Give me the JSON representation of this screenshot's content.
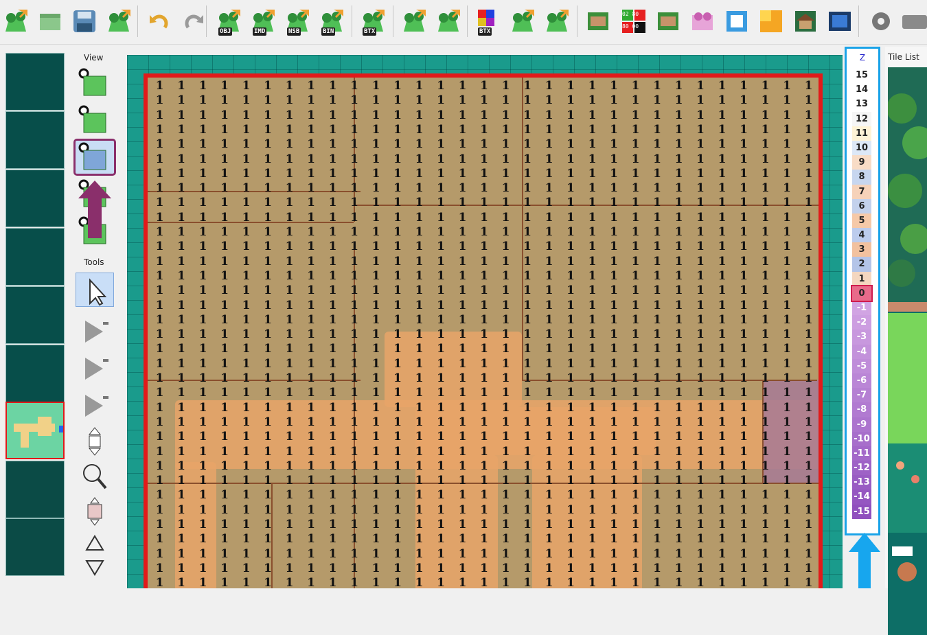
{
  "toolbar": {
    "buttons": [
      {
        "icon": "new-map-icon"
      },
      {
        "icon": "open-map-icon"
      },
      {
        "icon": "save-icon"
      },
      {
        "icon": "export-map-icon"
      },
      {
        "icon": "undo-icon"
      },
      {
        "icon": "redo-icon"
      },
      {
        "icon": "export-obj-icon",
        "label": "OBJ"
      },
      {
        "icon": "export-imd-icon",
        "label": "IMD"
      },
      {
        "icon": "export-nsb-icon",
        "label": "NSB"
      },
      {
        "icon": "export-bin-icon",
        "label": "BIN"
      },
      {
        "icon": "export-btx-icon",
        "label": "BTX"
      },
      {
        "icon": "export-single-icon"
      },
      {
        "icon": "export-star-icon"
      },
      {
        "icon": "texture-btx-icon",
        "label": "BTX"
      },
      {
        "icon": "texture-map-icon"
      },
      {
        "icon": "texture-map-2-icon"
      },
      {
        "icon": "tileset-icon"
      },
      {
        "icon": "collision-icon",
        "label_top": "02 80",
        "label_bottom": "80 00"
      },
      {
        "icon": "building-icon"
      },
      {
        "icon": "camera-icon"
      },
      {
        "icon": "music-icon"
      },
      {
        "icon": "color-icon"
      },
      {
        "icon": "house-icon"
      },
      {
        "icon": "screen-icon"
      },
      {
        "icon": "settings-gear-icon"
      },
      {
        "icon": "keyboard-icon"
      }
    ]
  },
  "view_panel": {
    "title": "View",
    "buttons": [
      "view-3d-map-icon",
      "view-tiles-icon",
      "view-collision-icon",
      "view-heights-icon",
      "view-grid-icon"
    ],
    "active_index": 2
  },
  "tools_panel": {
    "title": "Tools",
    "tools": [
      "select-arrow-icon",
      "remove-arrow-icon",
      "erase-arrow-icon",
      "clear-arrow-icon",
      "move-icon",
      "zoom-icon",
      "resize-icon",
      "move-up-icon",
      "move-down-icon"
    ],
    "active_index": 0
  },
  "z_panel": {
    "title": "Z",
    "values": [
      "15",
      "14",
      "13",
      "12",
      "11",
      "10",
      "9",
      "8",
      "7",
      "6",
      "5",
      "4",
      "3",
      "2",
      "1",
      "0",
      "-1",
      "-2",
      "-3",
      "-4",
      "-5",
      "-6",
      "-7",
      "-8",
      "-9",
      "-10",
      "-11",
      "-12",
      "-13",
      "-14",
      "-15"
    ],
    "selected": "0"
  },
  "tile_list": {
    "title": "Tile List"
  },
  "map": {
    "cell_value": "1",
    "cols": 31,
    "rows": 35
  },
  "colors": {
    "map_border": "#e21a1a",
    "z_panel_border": "#1aa3e8",
    "active_view_outline": "#8a2f6b",
    "terrain": "#b59a6a",
    "path": "#e8a468",
    "water": "#1a9b8c"
  }
}
